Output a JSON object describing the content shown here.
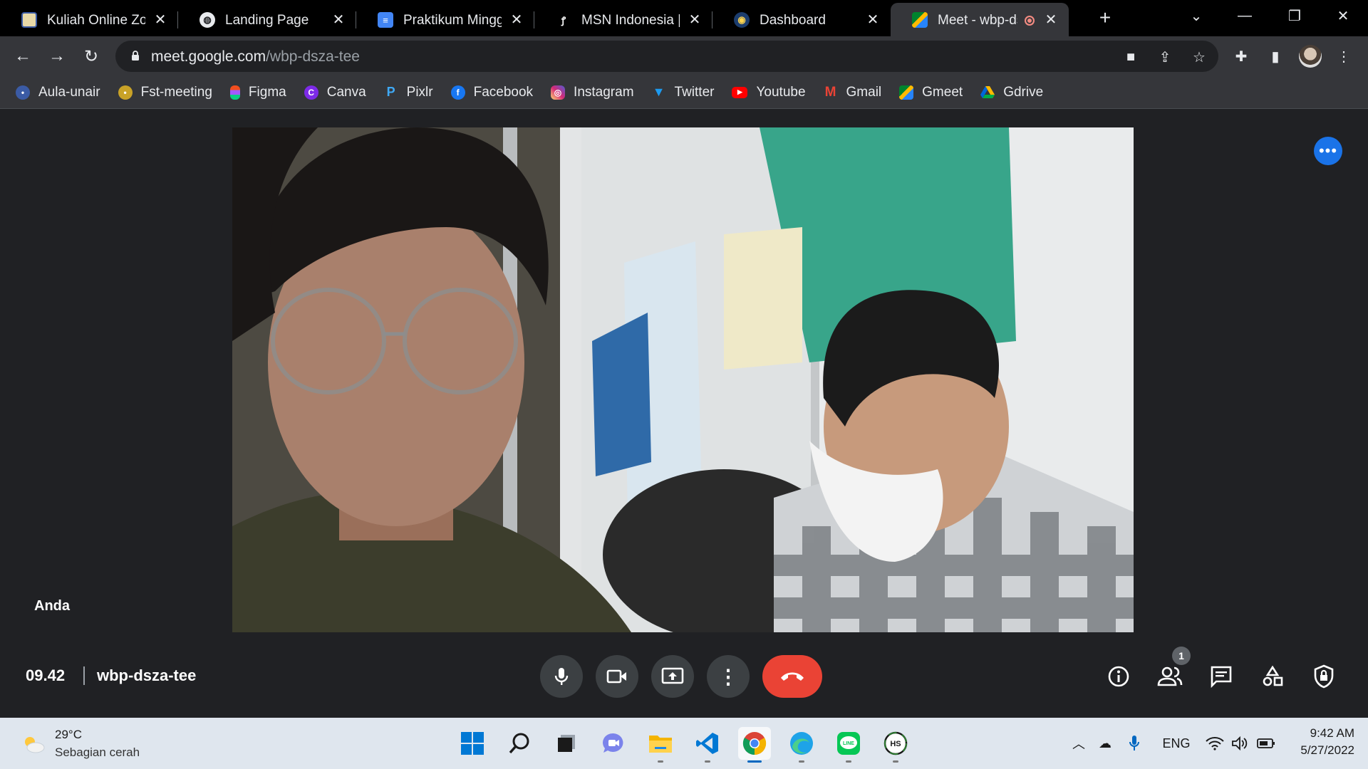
{
  "colors": {
    "browser_dark": "#000000",
    "toolbar": "#35363a",
    "meet_bg": "#202124",
    "end_call_red": "#ea4335",
    "accent_blue": "#1a73e8",
    "taskbar": "#dfe6ee"
  },
  "tabs": [
    {
      "title": "Kuliah Online Zoom",
      "icon": "unair-logo-icon",
      "active": false
    },
    {
      "title": "Landing Page",
      "icon": "globe-icon",
      "active": false
    },
    {
      "title": "Praktikum Minggu",
      "icon": "google-docs-icon",
      "active": false
    },
    {
      "title": "MSN Indonesia | Be",
      "icon": "msn-icon",
      "active": false
    },
    {
      "title": "Dashboard",
      "icon": "dashboard-logo-icon",
      "active": false
    },
    {
      "title": "Meet - wbp-dsza-tee",
      "icon": "google-meet-icon",
      "active": true,
      "recording": true
    }
  ],
  "address_bar": {
    "domain": "meet.google.com",
    "path": "/wbp-dsza-tee"
  },
  "bookmarks": [
    {
      "label": "Aula-unair",
      "icon": "unair-icon",
      "color": "#3b5ba5"
    },
    {
      "label": "Fst-meeting",
      "icon": "unair-icon",
      "color": "#c9a227"
    },
    {
      "label": "Figma",
      "icon": "figma-icon",
      "color": "#f24e1e"
    },
    {
      "label": "Canva",
      "icon": "canva-icon",
      "color": "#7d2ae8"
    },
    {
      "label": "Pixlr",
      "icon": "pixlr-icon",
      "color": "#3fa9f5"
    },
    {
      "label": "Facebook",
      "icon": "facebook-icon",
      "color": "#1877f2"
    },
    {
      "label": "Instagram",
      "icon": "instagram-icon",
      "color": "#d6249f"
    },
    {
      "label": "Twitter",
      "icon": "twitter-icon",
      "color": "#1d9bf0"
    },
    {
      "label": "Youtube",
      "icon": "youtube-icon",
      "color": "#ff0000"
    },
    {
      "label": "Gmail",
      "icon": "gmail-icon",
      "color": "#ea4335"
    },
    {
      "label": "Gmeet",
      "icon": "gmeet-icon",
      "color": "#00897b"
    },
    {
      "label": "Gdrive",
      "icon": "gdrive-icon",
      "color": "#34a853"
    }
  ],
  "meet": {
    "self_label": "Anda",
    "time": "09.42",
    "meeting_code": "wbp-dsza-tee",
    "participant_count": "1"
  },
  "taskbar": {
    "weather_temp": "29°C",
    "weather_desc": "Sebagian cerah",
    "language": "ENG",
    "time": "9:42 AM",
    "date": "5/27/2022",
    "pinned_apps": [
      "start-icon",
      "search-icon",
      "task-view-icon",
      "teams-chat-icon",
      "file-explorer-icon",
      "vscode-icon",
      "chrome-icon",
      "edge-icon",
      "line-icon",
      "hs-app-icon"
    ]
  }
}
